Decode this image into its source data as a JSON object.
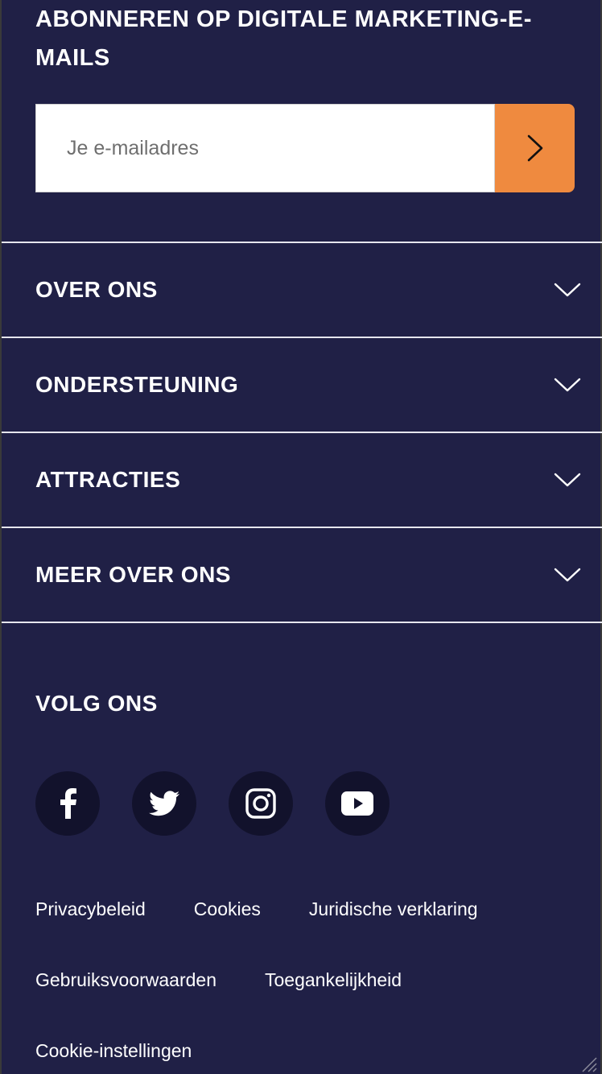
{
  "subscribe": {
    "title": "ABONNEREN OP DIGITALE MARKETING-E-MAILS",
    "email_placeholder": "Je e-mailadres",
    "submit_icon": "chevron-right-icon"
  },
  "accordion": {
    "items": [
      {
        "label": "OVER ONS",
        "icon": "chevron-down-icon"
      },
      {
        "label": "ONDERSTEUNING",
        "icon": "chevron-down-icon"
      },
      {
        "label": "ATTRACTIES",
        "icon": "chevron-down-icon"
      },
      {
        "label": "MEER OVER ONS",
        "icon": "chevron-down-icon"
      }
    ]
  },
  "follow": {
    "title": "VOLG ONS",
    "socials": [
      {
        "name": "facebook-icon"
      },
      {
        "name": "twitter-icon"
      },
      {
        "name": "instagram-icon"
      },
      {
        "name": "youtube-icon"
      }
    ]
  },
  "legal": {
    "links": [
      "Privacybeleid",
      "Cookies",
      "Juridische verklaring",
      "Gebruiksvoorwaarden",
      "Toegankelijkheid",
      "Cookie-instellingen"
    ]
  },
  "colors": {
    "background": "#202046",
    "accent": "#ef8a3f",
    "social_bg": "#12122c",
    "text": "#ffffff"
  }
}
